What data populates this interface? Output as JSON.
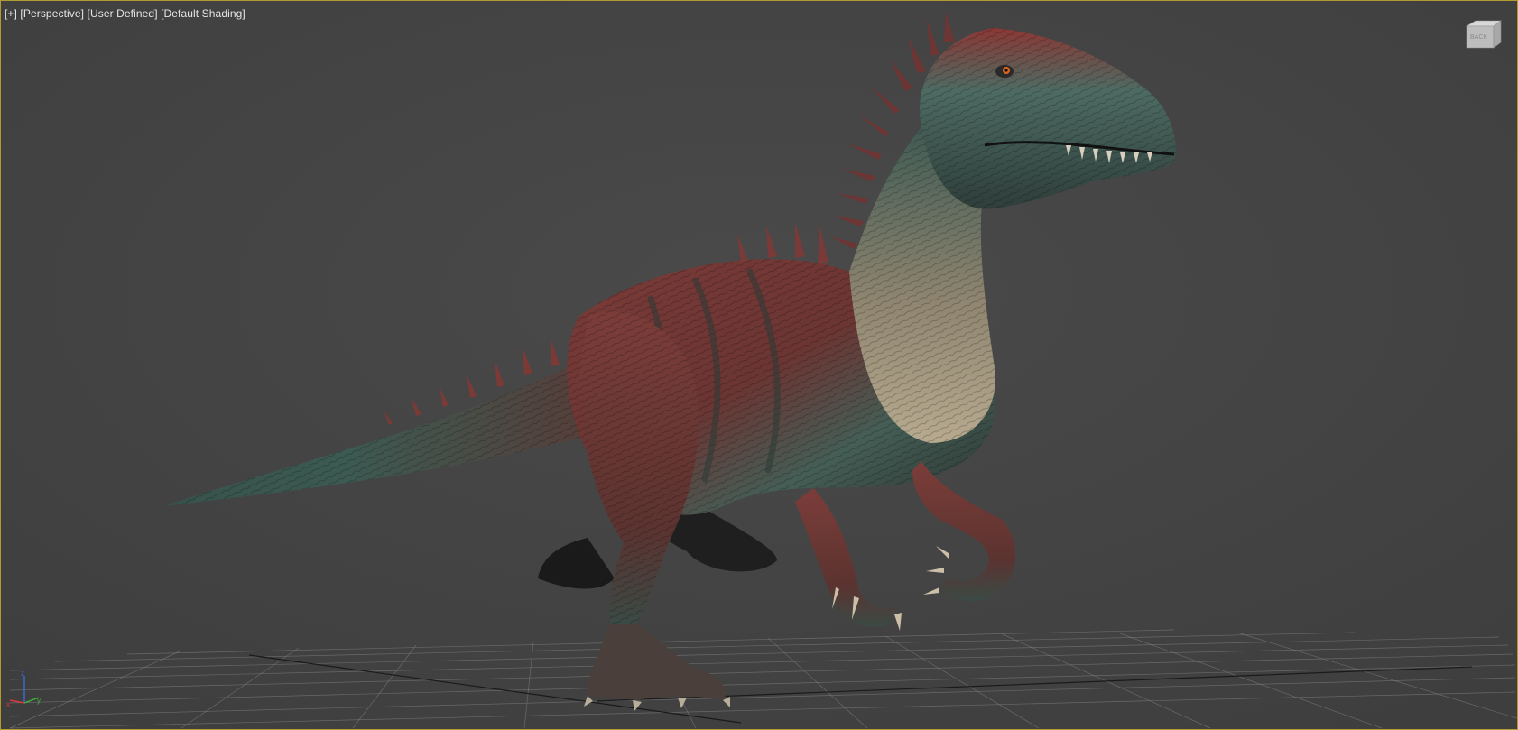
{
  "viewport": {
    "label": {
      "plus": "[+]",
      "view": "[Perspective]",
      "style": "[User Defined]",
      "shading": "[Default Shading]"
    },
    "viewcube_icon": "viewcube-icon",
    "axis_icon": "axis-tripod-icon",
    "subject": "creature-model",
    "colors": {
      "background": "#434343",
      "border": "#b39a2e",
      "grid": "#8a8a8a",
      "skin_red": "#7a3a37",
      "skin_teal": "#3e5c55",
      "skin_bone": "#b9ab90"
    }
  }
}
